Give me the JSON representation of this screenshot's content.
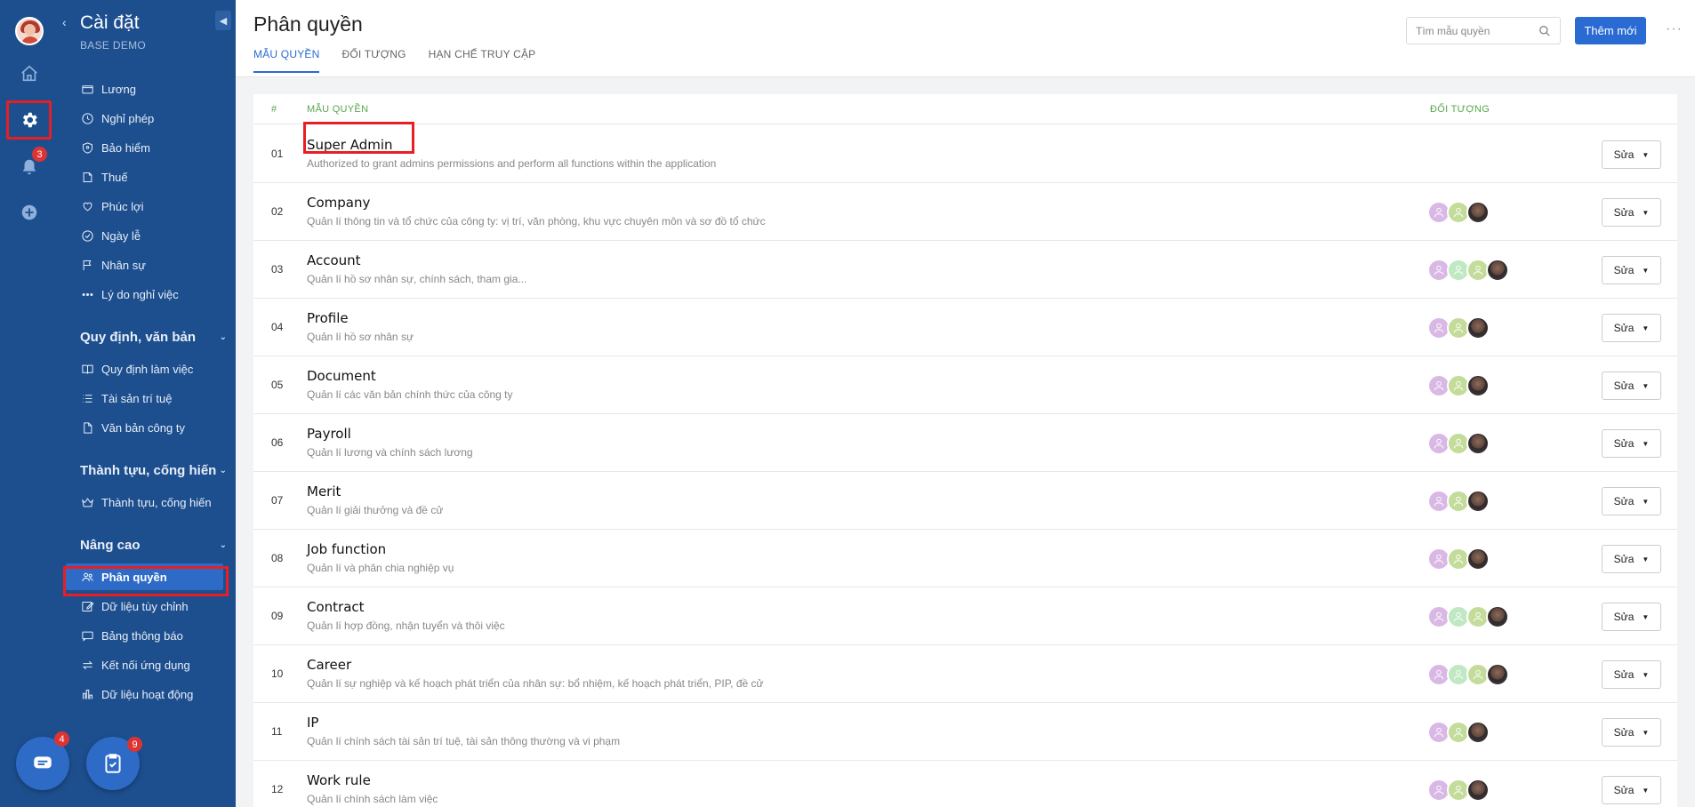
{
  "rail": {
    "notification_badge": "3"
  },
  "sidebar": {
    "title": "Cài đặt",
    "subtitle": "BASE DEMO",
    "top_items": [
      {
        "label": "Lương",
        "icon": "wallet-icon"
      },
      {
        "label": "Nghỉ phép",
        "icon": "clock-icon"
      },
      {
        "label": "Bảo hiểm",
        "icon": "shield-icon"
      },
      {
        "label": "Thuế",
        "icon": "document-icon"
      },
      {
        "label": "Phúc lợi",
        "icon": "heart-hand-icon"
      },
      {
        "label": "Ngày lễ",
        "icon": "check-circle-icon"
      },
      {
        "label": "Nhân sự",
        "icon": "flag-icon"
      },
      {
        "label": "Lý do nghỉ việc",
        "icon": "dots-icon"
      }
    ],
    "sections": [
      {
        "title": "Quy định, văn bản",
        "items": [
          {
            "label": "Quy định làm việc",
            "icon": "book-icon"
          },
          {
            "label": "Tài sản trí tuệ",
            "icon": "list-icon"
          },
          {
            "label": "Văn bản công ty",
            "icon": "file-icon"
          }
        ]
      },
      {
        "title": "Thành tựu, cống hiến",
        "items": [
          {
            "label": "Thành tựu, cống hiến",
            "icon": "crown-icon"
          }
        ]
      },
      {
        "title": "Nâng cao",
        "items": [
          {
            "label": "Phân quyền",
            "icon": "users-icon",
            "active": true
          },
          {
            "label": "Dữ liệu tùy chỉnh",
            "icon": "edit-icon"
          },
          {
            "label": "Bảng thông báo",
            "icon": "message-icon"
          },
          {
            "label": "Kết nối ứng dụng",
            "icon": "swap-icon"
          },
          {
            "label": "Dữ liệu hoạt động",
            "icon": "bar-chart-icon"
          }
        ]
      }
    ],
    "chat_badge": "4",
    "task_badge": "9"
  },
  "header": {
    "title": "Phân quyền",
    "tabs": [
      "MẪU QUYỀN",
      "ĐỐI TƯỢNG",
      "HẠN CHẾ TRUY CẬP"
    ],
    "search_placeholder": "Tìm mẫu quyền",
    "add_label": "Thêm mới",
    "more": "···"
  },
  "table": {
    "columns": {
      "index": "#",
      "template": "MẪU QUYỀN",
      "target": "ĐỐI TƯỢNG"
    },
    "edit_label": "Sửa",
    "rows": [
      {
        "no": "01",
        "name": "Super Admin",
        "desc": "Authorized to grant admins permissions and perform all functions within the application",
        "avatars": []
      },
      {
        "no": "02",
        "name": "Company",
        "desc": "Quản lí thông tin và tổ chức của công ty: vị trí, văn phòng, khu vực chuyên môn và sơ đồ tổ chức",
        "avatars": [
          "p",
          "g",
          "photo"
        ]
      },
      {
        "no": "03",
        "name": "Account",
        "desc": "Quản lí hồ sơ nhân sự, chính sách, tham gia...",
        "avatars": [
          "p",
          "g2",
          "g",
          "photo"
        ]
      },
      {
        "no": "04",
        "name": "Profile",
        "desc": "Quản lí hồ sơ nhân sự",
        "avatars": [
          "p",
          "g",
          "photo"
        ]
      },
      {
        "no": "05",
        "name": "Document",
        "desc": "Quản lí các văn bản chính thức của công ty",
        "avatars": [
          "p",
          "g",
          "photo"
        ]
      },
      {
        "no": "06",
        "name": "Payroll",
        "desc": "Quản lí lương và chính sách lương",
        "avatars": [
          "p",
          "g",
          "photo"
        ]
      },
      {
        "no": "07",
        "name": "Merit",
        "desc": "Quản lí giải thưởng và đề cử",
        "avatars": [
          "p",
          "g",
          "photo"
        ]
      },
      {
        "no": "08",
        "name": "Job function",
        "desc": "Quản lí và phân chia nghiệp vụ",
        "avatars": [
          "p",
          "g",
          "photo"
        ]
      },
      {
        "no": "09",
        "name": "Contract",
        "desc": "Quản lí hợp đồng, nhận tuyển và thôi việc",
        "avatars": [
          "p",
          "g2",
          "g",
          "photo"
        ]
      },
      {
        "no": "10",
        "name": "Career",
        "desc": "Quản lí sự nghiệp và kế hoạch phát triển của nhân sự: bổ nhiệm, kế hoạch phát triển, PIP, đề cử",
        "avatars": [
          "p",
          "g2",
          "g",
          "photo"
        ]
      },
      {
        "no": "11",
        "name": "IP",
        "desc": "Quản lí chính sách tài sản trí tuệ, tài sản thông thường và vi phạm",
        "avatars": [
          "p",
          "g",
          "photo"
        ]
      },
      {
        "no": "12",
        "name": "Work rule",
        "desc": "Quản lí chính sách làm việc",
        "avatars": [
          "p",
          "g",
          "photo"
        ]
      }
    ]
  }
}
